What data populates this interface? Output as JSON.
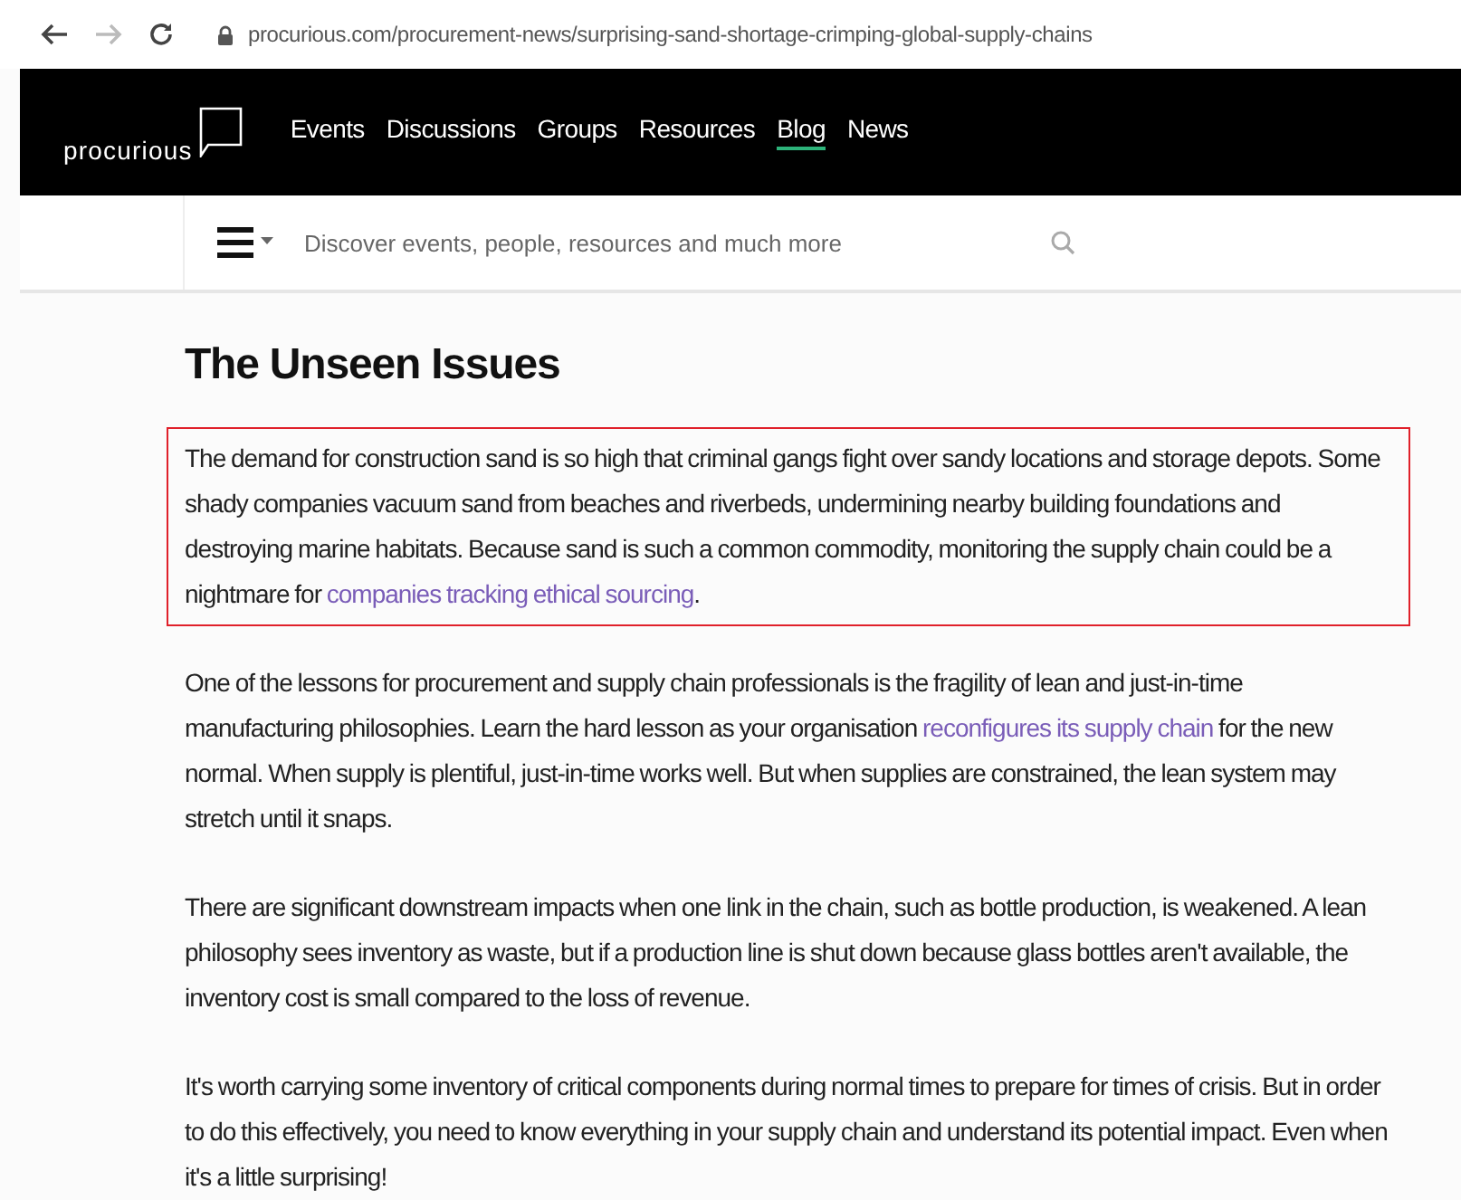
{
  "browser": {
    "buttons": [
      {
        "kind": "back",
        "disabled": false
      },
      {
        "kind": "forward",
        "disabled": true
      },
      {
        "kind": "reload",
        "disabled": false
      }
    ],
    "url": "procurious.com/procurement-news/surprising-sand-shortage-crimping-global-supply-chains"
  },
  "site_nav": {
    "logo": "procurious",
    "items": [
      {
        "label": "Events",
        "selected": false
      },
      {
        "label": "Discussions",
        "selected": false
      },
      {
        "label": "Groups",
        "selected": false
      },
      {
        "label": "Resources",
        "selected": false
      },
      {
        "label": "Blog",
        "selected": true
      },
      {
        "label": "News",
        "selected": false
      }
    ]
  },
  "search": {
    "placeholder": "Discover events, people, resources and much more"
  },
  "article": {
    "heading": "The Unseen Issues",
    "paragraphs": [
      {
        "highlighted": true,
        "segments": [
          {
            "kind": "text",
            "text": "The demand for construction sand is so high that criminal gangs fight over sandy locations and storage depots. Some shady companies vacuum sand from beaches and riverbeds, undermining nearby building foundations and destroying marine habitats. Because sand is such a common commodity, monitoring the supply chain could be a nightmare for "
          },
          {
            "kind": "link",
            "text": "companies tracking ethical sourcing"
          },
          {
            "kind": "text",
            "text": "."
          }
        ]
      },
      {
        "highlighted": false,
        "segments": [
          {
            "kind": "text",
            "text": "One of the lessons for procurement and supply chain professionals is the fragility of lean and just-in-time manufacturing philosophies. Learn the hard lesson as your organisation "
          },
          {
            "kind": "link",
            "text": "reconfigures its supply chain"
          },
          {
            "kind": "text",
            "text": " for the new normal. When supply is plentiful, just-in-time works well. But when supplies are constrained, the lean system may stretch until it snaps."
          }
        ]
      },
      {
        "highlighted": false,
        "segments": [
          {
            "kind": "text",
            "text": "There are significant downstream impacts when one link in the chain, such as bottle production, is weakened. A lean philosophy sees inventory as waste, but if a production line is shut down because glass bottles aren't available, the inventory cost is small compared to the loss of revenue."
          }
        ]
      },
      {
        "highlighted": false,
        "segments": [
          {
            "kind": "text",
            "text": "It's worth carrying some inventory of critical components during normal times to prepare for times of crisis. But in order to do this effectively, you need to know everything in your supply chain and understand its potential impact. Even when it's a little surprising!"
          }
        ]
      }
    ]
  }
}
